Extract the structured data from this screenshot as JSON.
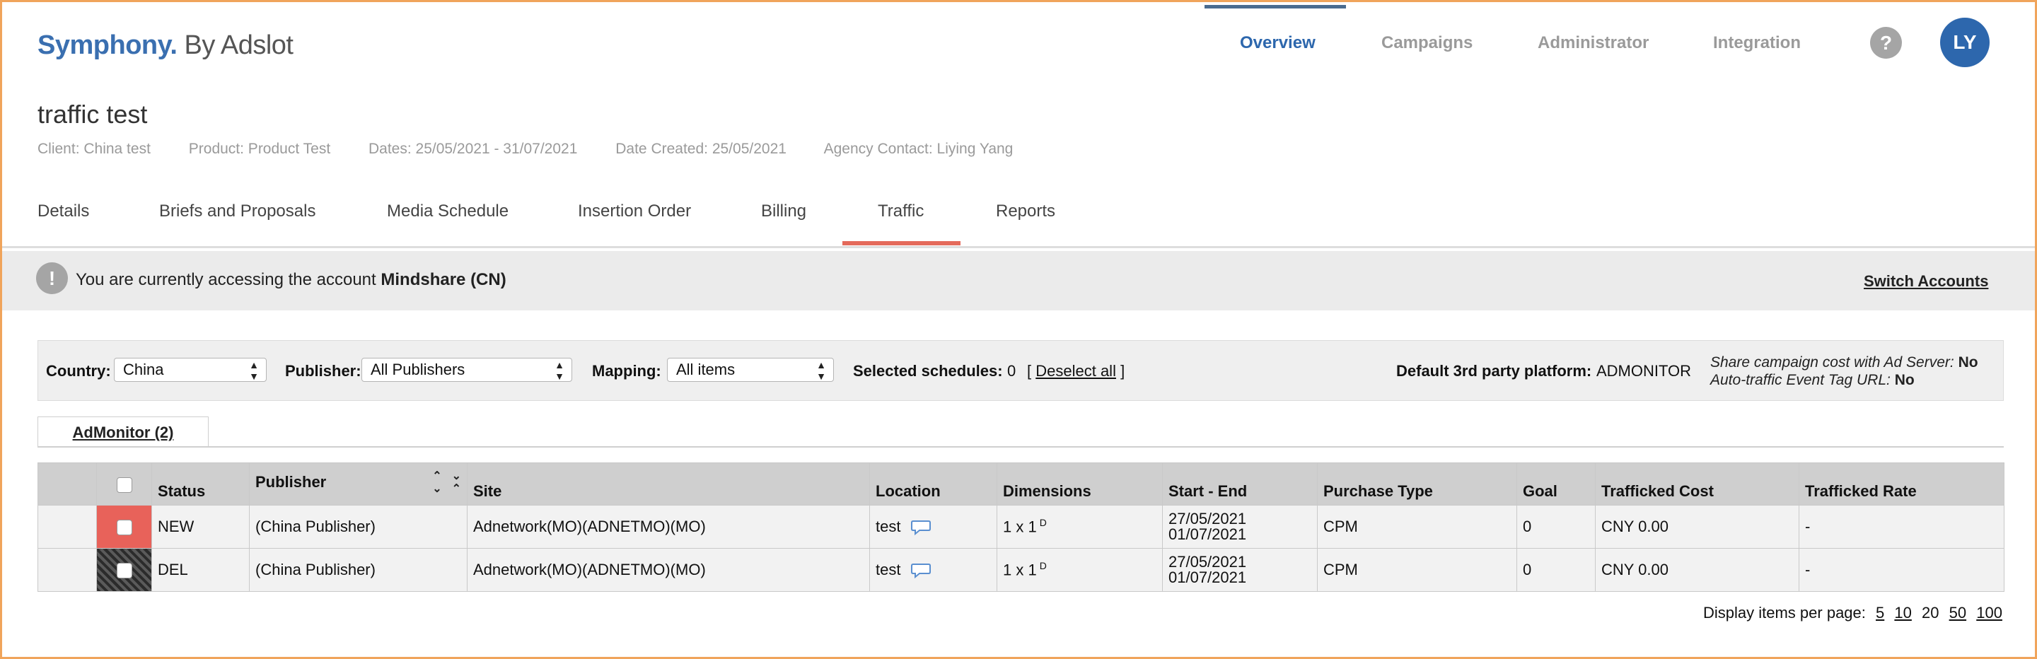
{
  "header": {
    "logo_brand": "Symphony.",
    "logo_by": " By Adslot",
    "nav": [
      {
        "label": "Overview",
        "active": true
      },
      {
        "label": "Campaigns",
        "active": false
      },
      {
        "label": "Administrator",
        "active": false
      },
      {
        "label": "Integration",
        "active": false
      }
    ],
    "help_label": "?",
    "avatar_initials": "LY"
  },
  "campaign": {
    "title": "traffic test",
    "meta": {
      "client": "Client: China test",
      "product": "Product: Product Test",
      "dates": "Dates: 25/05/2021 - 31/07/2021",
      "date_created": "Date Created: 25/05/2021",
      "agency_contact": "Agency Contact: Liying Yang"
    }
  },
  "subtabs": [
    {
      "label": "Details"
    },
    {
      "label": "Briefs and Proposals"
    },
    {
      "label": "Media Schedule"
    },
    {
      "label": "Insertion Order"
    },
    {
      "label": "Billing"
    },
    {
      "label": "Traffic",
      "active": true
    },
    {
      "label": "Reports"
    }
  ],
  "banner": {
    "icon": "!",
    "prefix": "You are currently accessing the account ",
    "account": "Mindshare (CN)",
    "switch_label": "Switch Accounts"
  },
  "filters": {
    "country_label": "Country:",
    "country_value": "China",
    "publisher_label": "Publisher:",
    "publisher_value": "All Publishers",
    "mapping_label": "Mapping:",
    "mapping_value": "All items",
    "selected_label": "Selected schedules:",
    "selected_count": "0",
    "deselect_open": "[ ",
    "deselect_label": "Deselect all",
    "deselect_close": " ]",
    "platform_label": "Default 3rd party platform:",
    "platform_value": "ADMONITOR",
    "share_cost_label": "Share campaign cost with Ad Server:",
    "share_cost_value": "No",
    "auto_traffic_label": "Auto-traffic Event Tag URL:",
    "auto_traffic_value": "No"
  },
  "platform_tab": {
    "label": "AdMonitor (2)"
  },
  "table": {
    "columns": {
      "status": "Status",
      "publisher": "Publisher",
      "site": "Site",
      "location": "Location",
      "dimensions": "Dimensions",
      "start_end": "Start - End",
      "purchase_type": "Purchase Type",
      "goal": "Goal",
      "trafficked_cost": "Trafficked Cost",
      "trafficked_rate": "Trafficked Rate"
    },
    "rows": [
      {
        "status": "NEW",
        "status_color": "#e8625a",
        "publisher": "(China Publisher)",
        "site": "Adnetwork(MO)(ADNETMO)(MO)",
        "location": "test",
        "dimensions": "1 x 1",
        "dimensions_sup": "D",
        "start": "27/05/2021",
        "end": "01/07/2021",
        "purchase_type": "CPM",
        "goal": "0",
        "trafficked_cost": "CNY 0.00",
        "trafficked_rate": "-"
      },
      {
        "status": "DEL",
        "status_color": "#2b2b2b",
        "publisher": "(China Publisher)",
        "site": "Adnetwork(MO)(ADNETMO)(MO)",
        "location": "test",
        "dimensions": "1 x 1",
        "dimensions_sup": "D",
        "start": "27/05/2021",
        "end": "01/07/2021",
        "purchase_type": "CPM",
        "goal": "0",
        "trafficked_cost": "CNY 0.00",
        "trafficked_rate": "-"
      }
    ]
  },
  "pager": {
    "label": "Display items per page:",
    "options": [
      "5",
      "10",
      "20",
      "50",
      "100"
    ],
    "current": "20"
  },
  "colors": {
    "brand": "#3a6fb0",
    "active_tab": "#e46a5b",
    "status_new": "#e8625a"
  }
}
